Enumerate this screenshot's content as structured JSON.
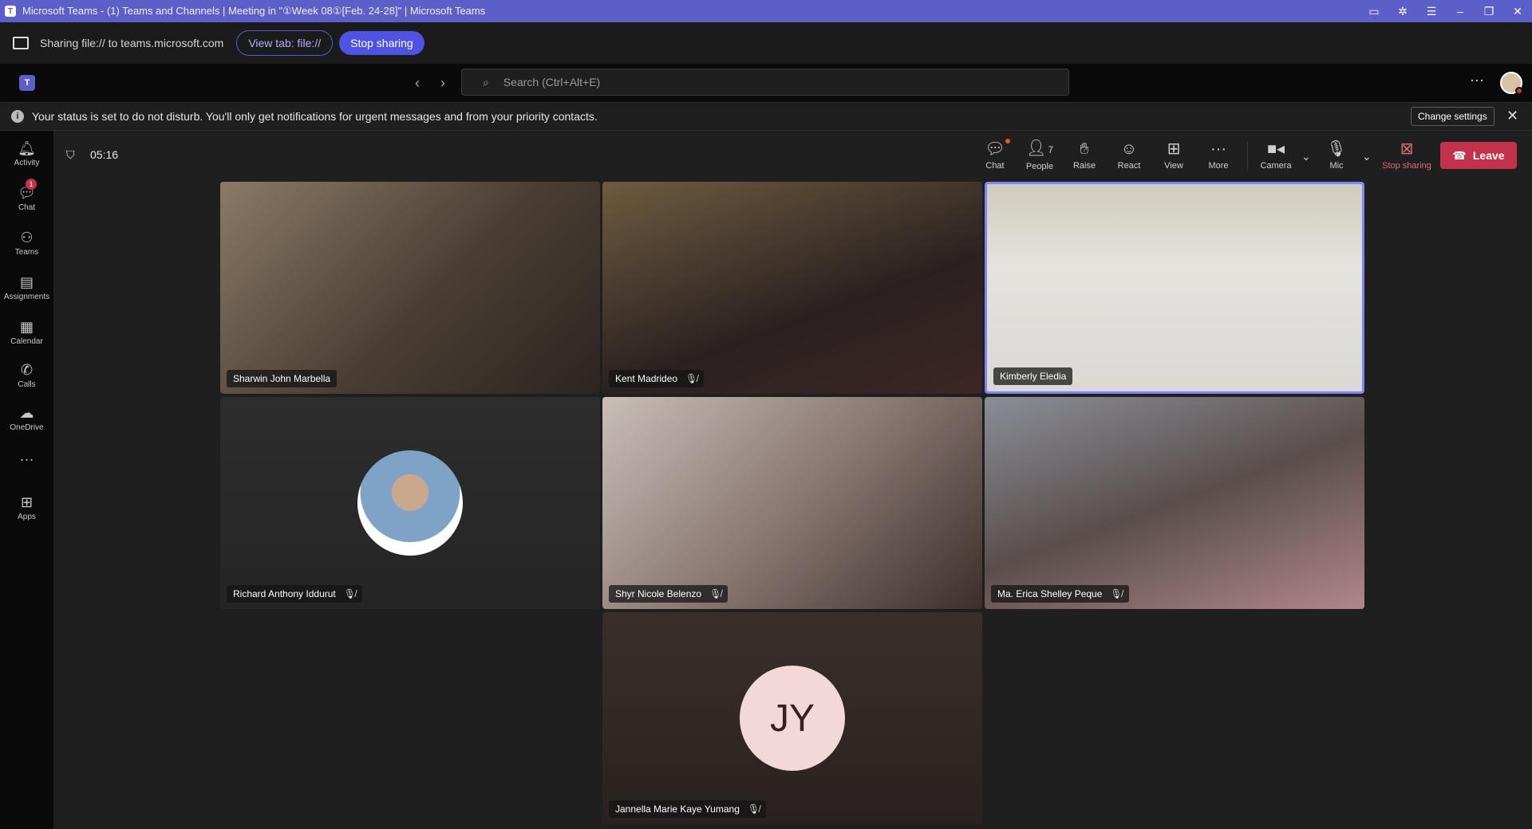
{
  "window": {
    "title": "Microsoft Teams - (1) Teams and Channels | Meeting in \"①Week 08①[Feb. 24-28]\" | Microsoft Teams"
  },
  "sharebar": {
    "text": "Sharing file:// to teams.microsoft.com",
    "view_tab": "View tab: file://",
    "stop_sharing": "Stop sharing"
  },
  "appbar": {
    "search_placeholder": "Search (Ctrl+Alt+E)"
  },
  "banner": {
    "message": "Your status is set to do not disturb. You'll only get notifications for urgent messages and from your priority contacts.",
    "change_settings": "Change settings"
  },
  "rail": [
    {
      "label": "Activity",
      "icon": "bell-icon"
    },
    {
      "label": "Chat",
      "icon": "chat-icon",
      "badge": "1"
    },
    {
      "label": "Teams",
      "icon": "teams-icon"
    },
    {
      "label": "Assignments",
      "icon": "assignments-icon"
    },
    {
      "label": "Calendar",
      "icon": "calendar-icon"
    },
    {
      "label": "Calls",
      "icon": "phone-icon"
    },
    {
      "label": "OneDrive",
      "icon": "cloud-icon"
    },
    {
      "label": "Apps",
      "icon": "apps-icon"
    }
  ],
  "call": {
    "timer": "05:16",
    "controls": {
      "chat": "Chat",
      "people": "People",
      "people_count": "7",
      "raise": "Raise",
      "react": "React",
      "view": "View",
      "more": "More",
      "camera": "Camera",
      "mic": "Mic",
      "stop_sharing": "Stop sharing",
      "leave": "Leave"
    },
    "participants": [
      {
        "name": "Sharwin John Marbella",
        "muted": false,
        "bg": "#6b5d4f"
      },
      {
        "name": "Kent Madrideo",
        "muted": true,
        "bg": "#3a3130"
      },
      {
        "name": "Kimberly Eledia",
        "muted": false,
        "bg": "#d4d2cc",
        "active": true
      },
      {
        "name": "Richard Anthony Iddurut",
        "muted": true,
        "bg": "#2a2a2a"
      },
      {
        "name": "Shyr Nicole Belenzo",
        "muted": true,
        "bg": "#a89a94"
      },
      {
        "name": "Ma. Erica Shelley Peque",
        "muted": true,
        "bg": "#6c6a6b"
      },
      {
        "name": "Jannella Marie Kaye Yumang",
        "muted": true,
        "bg": "#2e2523",
        "initials": "JY"
      }
    ]
  }
}
